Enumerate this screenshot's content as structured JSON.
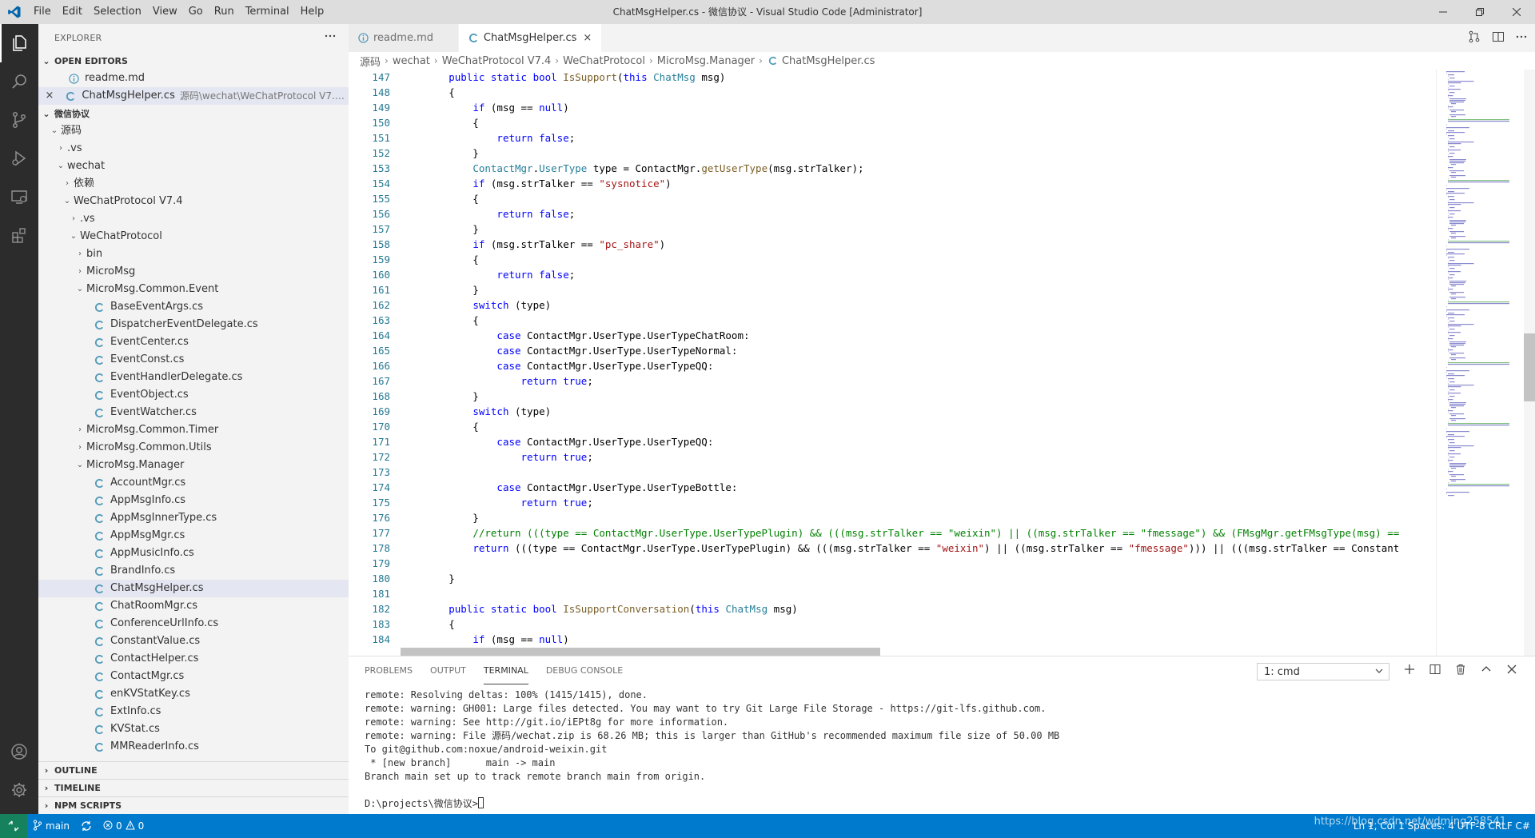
{
  "window": {
    "title": "ChatMsgHelper.cs - 微信协议 - Visual Studio Code [Administrator]",
    "menu": [
      "File",
      "Edit",
      "Selection",
      "View",
      "Go",
      "Run",
      "Terminal",
      "Help"
    ]
  },
  "colors": {
    "accent": "#007acc",
    "remote": "#16825d",
    "activity_bar": "#2c2c2c",
    "sidebar": "#f3f3f3"
  },
  "activity_bar": {
    "items": [
      "files-icon",
      "search-icon",
      "source-control-icon",
      "run-debug-icon",
      "remote-explorer-icon",
      "extensions-icon"
    ],
    "bottom": [
      "account-icon",
      "settings-gear-icon"
    ]
  },
  "sidebar": {
    "header": "EXPLORER",
    "open_editors": {
      "title": "OPEN EDITORS",
      "items": [
        {
          "name": "readme.md",
          "path": ""
        },
        {
          "name": "ChatMsgHelper.cs",
          "path": "源码\\wechat\\WeChatProtocol V7.4\\WeC..."
        }
      ]
    },
    "workspace": {
      "title": "微信协议",
      "tree": [
        {
          "label": "源码",
          "depth": 0,
          "type": "folder-open"
        },
        {
          "label": ".vs",
          "depth": 1,
          "type": "folder"
        },
        {
          "label": "wechat",
          "depth": 1,
          "type": "folder-open"
        },
        {
          "label": "依赖",
          "depth": 2,
          "type": "folder"
        },
        {
          "label": "WeChatProtocol V7.4",
          "depth": 2,
          "type": "folder-open"
        },
        {
          "label": ".vs",
          "depth": 3,
          "type": "folder"
        },
        {
          "label": "WeChatProtocol",
          "depth": 3,
          "type": "folder-open"
        },
        {
          "label": "bin",
          "depth": 4,
          "type": "folder"
        },
        {
          "label": "MicroMsg",
          "depth": 4,
          "type": "folder"
        },
        {
          "label": "MicroMsg.Common.Event",
          "depth": 4,
          "type": "folder-open"
        },
        {
          "label": "BaseEventArgs.cs",
          "depth": 5,
          "type": "cs"
        },
        {
          "label": "DispatcherEventDelegate.cs",
          "depth": 5,
          "type": "cs"
        },
        {
          "label": "EventCenter.cs",
          "depth": 5,
          "type": "cs"
        },
        {
          "label": "EventConst.cs",
          "depth": 5,
          "type": "cs"
        },
        {
          "label": "EventHandlerDelegate.cs",
          "depth": 5,
          "type": "cs"
        },
        {
          "label": "EventObject.cs",
          "depth": 5,
          "type": "cs"
        },
        {
          "label": "EventWatcher.cs",
          "depth": 5,
          "type": "cs"
        },
        {
          "label": "MicroMsg.Common.Timer",
          "depth": 4,
          "type": "folder"
        },
        {
          "label": "MicroMsg.Common.Utils",
          "depth": 4,
          "type": "folder"
        },
        {
          "label": "MicroMsg.Manager",
          "depth": 4,
          "type": "folder-open"
        },
        {
          "label": "AccountMgr.cs",
          "depth": 5,
          "type": "cs"
        },
        {
          "label": "AppMsgInfo.cs",
          "depth": 5,
          "type": "cs"
        },
        {
          "label": "AppMsgInnerType.cs",
          "depth": 5,
          "type": "cs"
        },
        {
          "label": "AppMsgMgr.cs",
          "depth": 5,
          "type": "cs"
        },
        {
          "label": "AppMusicInfo.cs",
          "depth": 5,
          "type": "cs"
        },
        {
          "label": "BrandInfo.cs",
          "depth": 5,
          "type": "cs"
        },
        {
          "label": "ChatMsgHelper.cs",
          "depth": 5,
          "type": "cs",
          "selected": true
        },
        {
          "label": "ChatRoomMgr.cs",
          "depth": 5,
          "type": "cs"
        },
        {
          "label": "ConferenceUrlInfo.cs",
          "depth": 5,
          "type": "cs"
        },
        {
          "label": "ConstantValue.cs",
          "depth": 5,
          "type": "cs"
        },
        {
          "label": "ContactHelper.cs",
          "depth": 5,
          "type": "cs"
        },
        {
          "label": "ContactMgr.cs",
          "depth": 5,
          "type": "cs"
        },
        {
          "label": "enKVStatKey.cs",
          "depth": 5,
          "type": "cs"
        },
        {
          "label": "ExtInfo.cs",
          "depth": 5,
          "type": "cs"
        },
        {
          "label": "KVStat.cs",
          "depth": 5,
          "type": "cs"
        },
        {
          "label": "MMReaderInfo.cs",
          "depth": 5,
          "type": "cs"
        }
      ]
    },
    "sections": [
      "OUTLINE",
      "TIMELINE",
      "NPM SCRIPTS"
    ]
  },
  "editor": {
    "tabs": [
      {
        "label": "readme.md",
        "active": false
      },
      {
        "label": "ChatMsgHelper.cs",
        "active": true
      }
    ],
    "breadcrumb": [
      "源码",
      "wechat",
      "WeChatProtocol V7.4",
      "WeChatProtocol",
      "MicroMsg.Manager",
      "ChatMsgHelper.cs"
    ],
    "first_line_number": 147,
    "lines": [
      "        public static bool IsSupport(this ChatMsg msg)",
      "        {",
      "            if (msg == null)",
      "            {",
      "                return false;",
      "            }",
      "            ContactMgr.UserType type = ContactMgr.getUserType(msg.strTalker);",
      "            if (msg.strTalker == \"sysnotice\")",
      "            {",
      "                return false;",
      "            }",
      "            if (msg.strTalker == \"pc_share\")",
      "            {",
      "                return false;",
      "            }",
      "            switch (type)",
      "            {",
      "                case ContactMgr.UserType.UserTypeChatRoom:",
      "                case ContactMgr.UserType.UserTypeNormal:",
      "                case ContactMgr.UserType.UserTypeQQ:",
      "                    return true;",
      "            }",
      "            switch (type)",
      "            {",
      "                case ContactMgr.UserType.UserTypeQQ:",
      "                    return true;",
      "",
      "                case ContactMgr.UserType.UserTypeBottle:",
      "                    return true;",
      "            }",
      "            //return (((type == ContactMgr.UserType.UserTypePlugin) && (((msg.strTalker == \"weixin\") || ((msg.strTalker == \"fmessage\") && (FMsgMgr.getFMsgType(msg) ==",
      "            return (((type == ContactMgr.UserType.UserTypePlugin) && (((msg.strTalker == \"weixin\") || ((msg.strTalker == \"fmessage\"))) || (((msg.strTalker == Constant",
      "",
      "        }",
      "",
      "        public static bool IsSupportConversation(this ChatMsg msg)",
      "        {",
      "            if (msg == null)"
    ]
  },
  "panel": {
    "tabs": [
      "PROBLEMS",
      "OUTPUT",
      "TERMINAL",
      "DEBUG CONSOLE"
    ],
    "active_tab": "TERMINAL",
    "terminal_select": "1: cmd",
    "terminal_lines": [
      "remote: Resolving deltas: 100% (1415/1415), done.",
      "remote: warning: GH001: Large files detected. You may want to try Git Large File Storage - https://git-lfs.github.com.",
      "remote: warning: See http://git.io/iEPt8g for more information.",
      "remote: warning: File 源码/wechat.zip is 68.26 MB; this is larger than GitHub's recommended maximum file size of 50.00 MB",
      "To git@github.com:noxue/android-weixin.git",
      " * [new branch]      main -> main",
      "Branch main set up to track remote branch main from origin.",
      "",
      "D:\\projects\\微信协议>"
    ]
  },
  "statusbar": {
    "branch": "main",
    "errors": "0",
    "warnings": "0",
    "right": "Ln 1, Col 1   Spaces: 4   UTF-8   CRLF   C#",
    "watermark": "https://blog.csdn.net/wdming258541"
  }
}
